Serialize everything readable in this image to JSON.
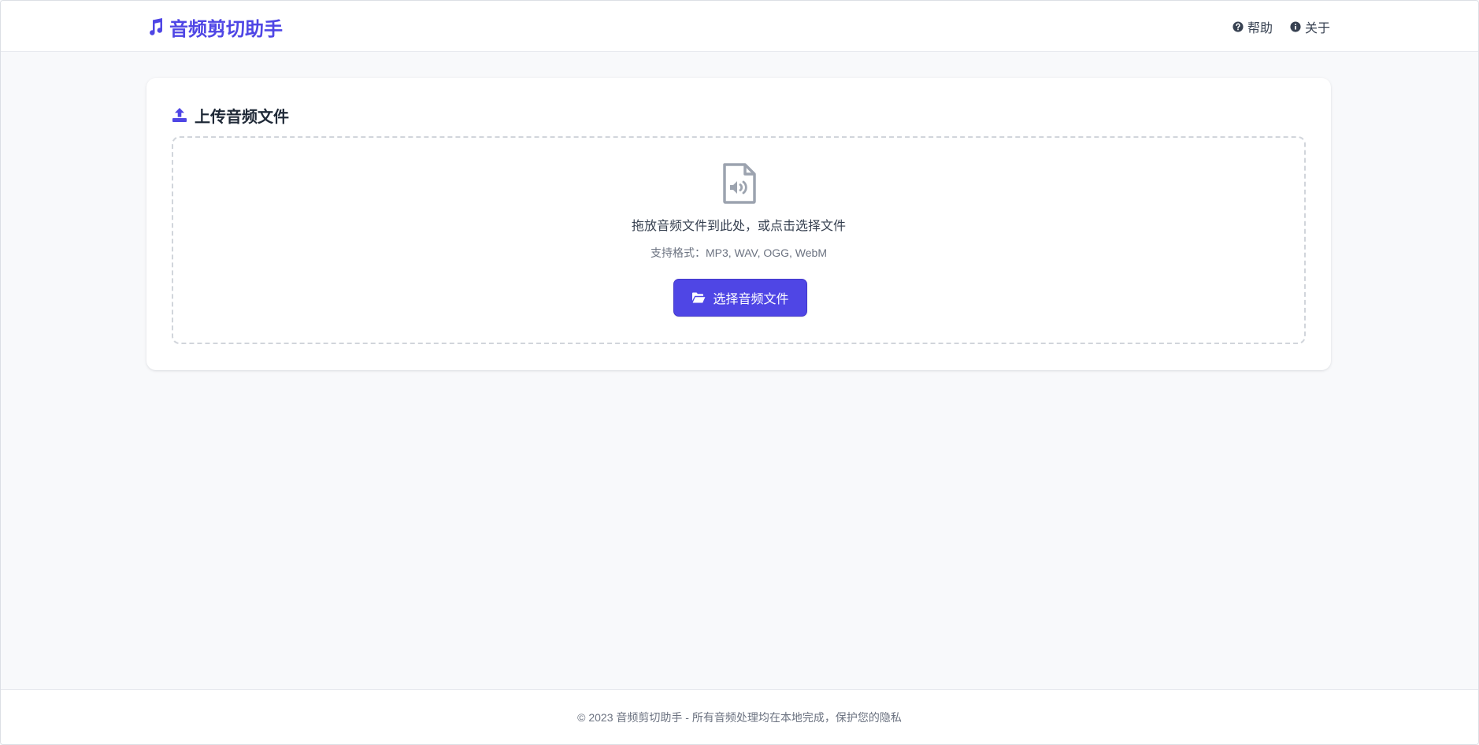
{
  "header": {
    "brand": {
      "title": "音频剪切助手",
      "icon": "music-note-icon"
    },
    "nav": [
      {
        "label": "帮助",
        "icon": "question-circle-icon"
      },
      {
        "label": "关于",
        "icon": "info-circle-icon"
      }
    ]
  },
  "upload": {
    "title": "上传音频文件",
    "title_icon": "upload-icon",
    "dropzone_icon": "audio-file-icon",
    "drop_text": "拖放音频文件到此处，或点击选择文件",
    "formats_text": "支持格式：MP3, WAV, OGG, WebM",
    "button": {
      "label": "选择音频文件",
      "icon": "folder-open-icon"
    }
  },
  "footer": {
    "text": "© 2023 音频剪切助手 - 所有音频处理均在本地完成，保护您的隐私"
  },
  "colors": {
    "accent": "#4f46e5",
    "background": "#f8f9fb",
    "card": "#ffffff",
    "text": "#374151",
    "muted": "#6b7280",
    "dropzone_border": "#d1d5db",
    "icon_gray": "#9ca3af"
  }
}
